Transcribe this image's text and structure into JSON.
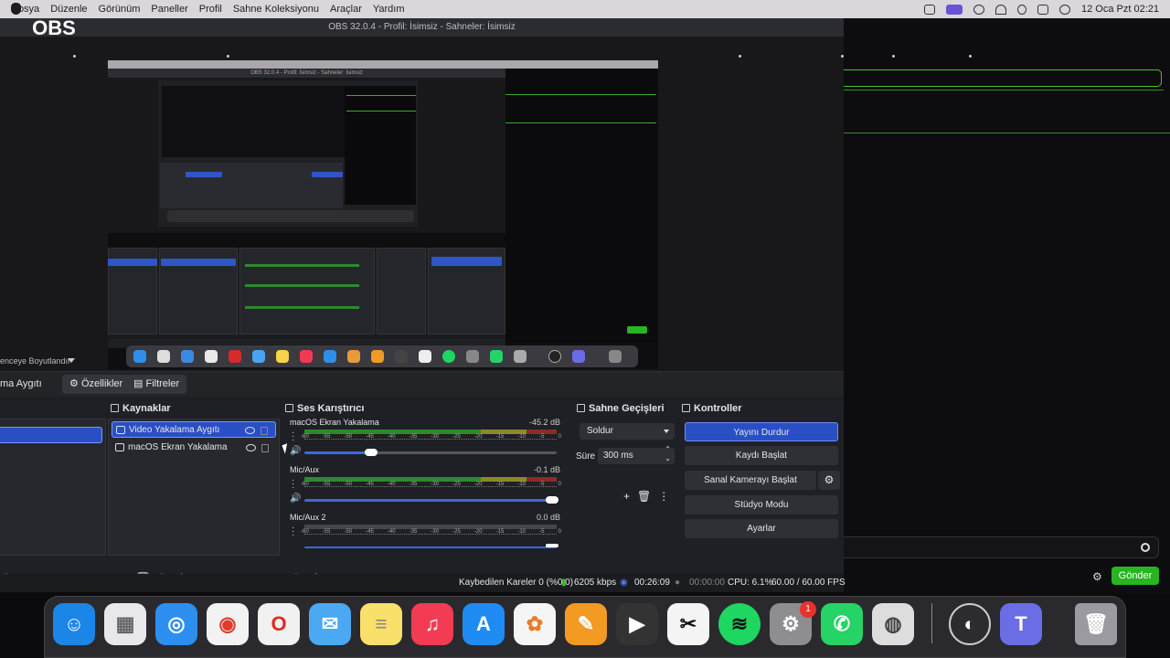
{
  "menubar": {
    "app": "OBS",
    "items": [
      "Dosya",
      "Düzenle",
      "Görünüm",
      "Paneller",
      "Profil",
      "Sahne Koleksiyonu",
      "Araçlar",
      "Yardım"
    ],
    "clock": "12 Oca Pzt  02:21"
  },
  "obs": {
    "title": "OBS 32.0.4 - Profil: İsimsiz - Sahneler: İsimsiz",
    "toolbar": {
      "selected_source": "ma Aygıtı",
      "properties": "Özellikler",
      "filters": "Filtreler",
      "scale_hint": "enceye Boyutlandır"
    },
    "sources": {
      "title": "Kaynaklar",
      "items": [
        {
          "label": "Video Yakalama Aygıtı",
          "selected": true
        },
        {
          "label": "macOS Ekran Yakalama",
          "selected": false
        }
      ]
    },
    "mixer": {
      "title": "Ses Karıştırıcı",
      "scale": [
        "-60",
        "-55",
        "-50",
        "-45",
        "-40",
        "-35",
        "-30",
        "-25",
        "-20",
        "-15",
        "-10",
        "-5",
        "0"
      ],
      "channels": [
        {
          "name": "macOS Ekran Yakalama",
          "db": "-45.2 dB",
          "volume": 0.28
        },
        {
          "name": "Mic/Aux",
          "db": "-0.1 dB",
          "volume": 1.0
        },
        {
          "name": "Mic/Aux 2",
          "db": "0.0 dB",
          "volume": 1.0
        }
      ]
    },
    "transitions": {
      "title": "Sahne Geçişleri",
      "type": "Soldur",
      "duration_label": "Süre",
      "duration": "300 ms"
    },
    "controls": {
      "title": "Kontroller",
      "stop_stream": "Yayını Durdur",
      "start_record": "Kaydı Başlat",
      "start_vcam": "Sanal Kamerayı Başlat",
      "studio_mode": "Stüdyo Modu",
      "settings": "Ayarlar"
    },
    "status": {
      "dropped": "Kaybedilen Kareler 0 (%0.0)",
      "bitrate": "6205 kbps",
      "stream_time": "00:26:09",
      "record_time": "00:00:00",
      "cpu": "CPU: 6.1%",
      "fps": "60.00 / 60.00 FPS"
    }
  },
  "side": {
    "send": "Gönder"
  },
  "dock": {
    "apps": [
      "Finder",
      "Launchpad",
      "Safari",
      "Chrome",
      "Opera",
      "Mail",
      "Notes",
      "Music",
      "App Store",
      "Photos",
      "Pages",
      "Final Cut Pro",
      "CapCut",
      "Spotify",
      "System Settings",
      "WhatsApp",
      "Compressor",
      "OBS",
      "Teams",
      "Trash"
    ],
    "settings_badge": "1"
  }
}
